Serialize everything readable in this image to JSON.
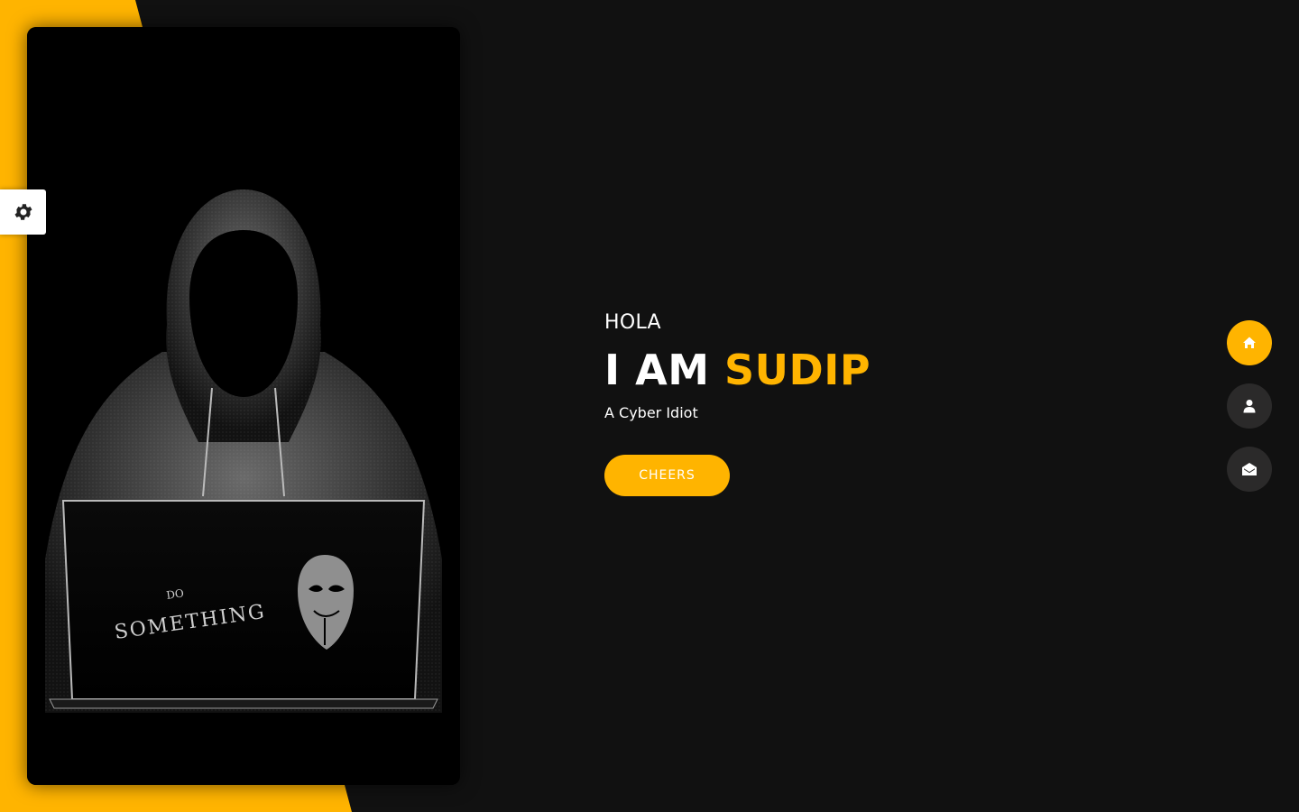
{
  "hero": {
    "greeting": "HOLA",
    "headline_prefix": "I AM",
    "headline_name": "SUDIP",
    "tagline": "A Cyber Idiot",
    "button_label": "CHEERS"
  },
  "photo": {
    "laptop_sticker_small": "DO",
    "laptop_sticker_large": "SOMETHING"
  },
  "nav": {
    "items": [
      {
        "icon": "home-icon",
        "active": true
      },
      {
        "icon": "user-icon",
        "active": false
      },
      {
        "icon": "envelope-open-icon",
        "active": false
      }
    ]
  },
  "settings": {
    "icon": "gear-icon"
  },
  "colors": {
    "accent": "#ffb400",
    "background": "#111111",
    "nav_inactive": "#2b2a2a",
    "text": "#ffffff"
  }
}
